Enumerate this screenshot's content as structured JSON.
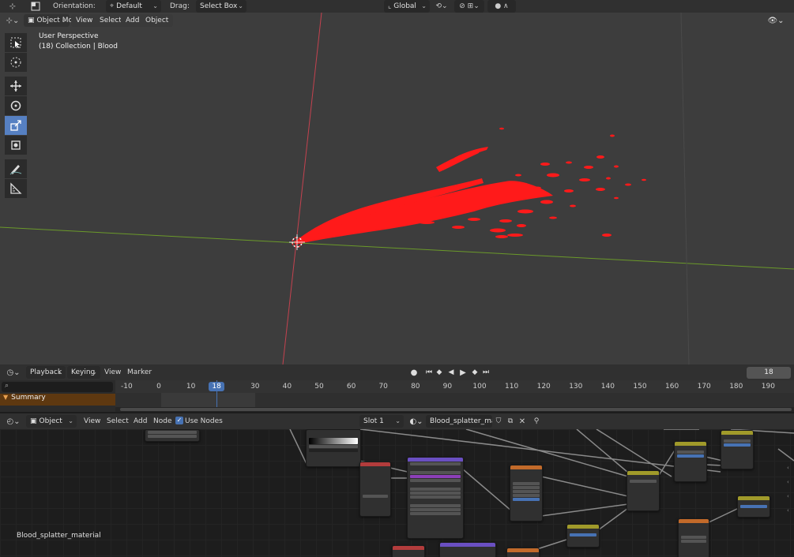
{
  "top_bar": {
    "orientation_label": "Orientation:",
    "orientation_value": "Default",
    "drag_label": "Drag:",
    "drag_value": "Select Box",
    "transform_orientation": "Global"
  },
  "viewport": {
    "mode": "Object Mode",
    "menu": [
      "View",
      "Select",
      "Add",
      "Object"
    ],
    "overlay_line1": "User Perspective",
    "overlay_line2": "(18) Collection | Blood",
    "tools": [
      "select-box-icon",
      "cursor-icon",
      "move-icon",
      "rotate-icon",
      "scale-icon",
      "transform-icon",
      "annotate-icon",
      "measure-icon"
    ],
    "active_tool_index": 4
  },
  "timeline": {
    "menu": [
      "Playback",
      "Keying",
      "View",
      "Marker"
    ],
    "current_frame": "18",
    "ruler_ticks": [
      "-10",
      "0",
      "10",
      "18",
      "30",
      "40",
      "50",
      "60",
      "70",
      "80",
      "90",
      "100",
      "110",
      "120",
      "130",
      "140",
      "150",
      "160",
      "170",
      "180",
      "190"
    ],
    "summary_label": "Summary"
  },
  "node_editor": {
    "type": "Object",
    "menu": [
      "View",
      "Select",
      "Add",
      "Node"
    ],
    "use_nodes_label": "Use Nodes",
    "slot": "Slot 1",
    "material": "Blood_splatter_mat...",
    "material_name_label": "Blood_splatter_material"
  },
  "colors": {
    "accent": "#4772b3",
    "blood": "#ff1a1a",
    "x_axis": "#c4424f",
    "y_axis": "#6b9a2a",
    "summary_bg": "#5e3810"
  }
}
